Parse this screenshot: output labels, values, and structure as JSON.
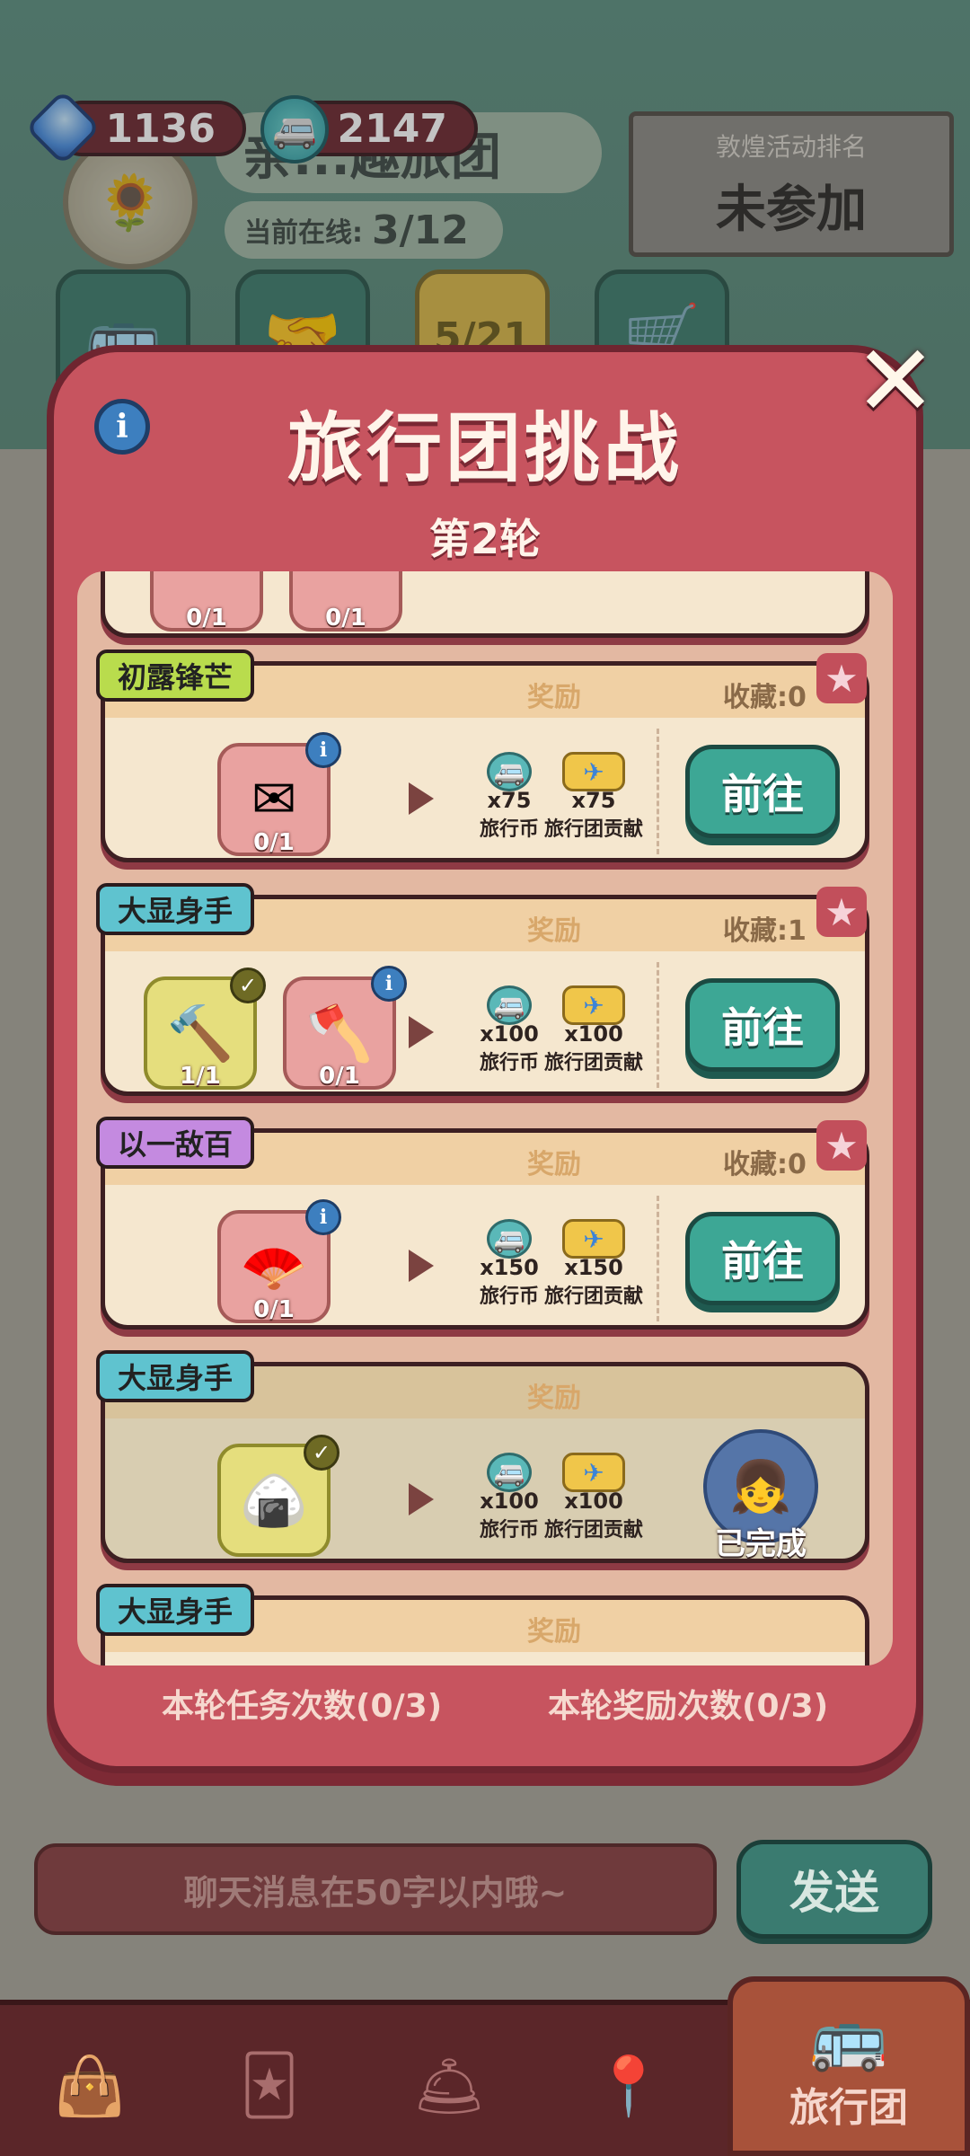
{
  "top_bar": {
    "gems": "1136",
    "travel_coins": "2147",
    "room_title": "亲...趣旅团",
    "online_label": "当前在线:",
    "online_count": "3/12",
    "rank_header": "敦煌活动排名",
    "rank_value": "未参加",
    "event_badge": "5/21"
  },
  "modal": {
    "title": "旅行团挑战",
    "round": "第2轮",
    "reward_label": "奖励",
    "go_label": "前往",
    "done_label": "已完成",
    "coin_name": "旅行币",
    "contrib_name": "旅行团贡献",
    "partial_top": {
      "counts": [
        "0/1",
        "0/1"
      ]
    },
    "cards": [
      {
        "tag": "初露锋芒",
        "tag_color": "green",
        "collect": "收藏:0",
        "items": [
          {
            "icon": "envelope-icon",
            "count": "0/1",
            "done": false
          }
        ],
        "coin_amt": "x75",
        "contrib_amt": "x75",
        "status": "go"
      },
      {
        "tag": "大显身手",
        "tag_color": "teal",
        "collect": "收藏:1",
        "items": [
          {
            "icon": "hammer-icon",
            "count": "1/1",
            "done": true
          },
          {
            "icon": "mallet-icon",
            "count": "0/1",
            "done": false
          }
        ],
        "coin_amt": "x100",
        "contrib_amt": "x100",
        "status": "go"
      },
      {
        "tag": "以一敌百",
        "tag_color": "purple",
        "collect": "收藏:0",
        "items": [
          {
            "icon": "fan-icon",
            "count": "0/1",
            "done": false
          }
        ],
        "coin_amt": "x150",
        "contrib_amt": "x150",
        "status": "go"
      },
      {
        "tag": "大显身手",
        "tag_color": "teal",
        "collect": "",
        "items": [
          {
            "icon": "rice-dumpling-icon",
            "count": "",
            "done": true
          }
        ],
        "coin_amt": "x100",
        "contrib_amt": "x100",
        "status": "done"
      },
      {
        "tag": "大显身手",
        "tag_color": "teal",
        "collect": ""
      }
    ],
    "task_count": "本轮任务次数(0/3)",
    "reward_count": "本轮奖励次数(0/3)"
  },
  "chat": {
    "placeholder": "聊天消息在50字以内哦~",
    "send_label": "发送"
  },
  "bottom_nav": {
    "active_label": "旅行团"
  }
}
